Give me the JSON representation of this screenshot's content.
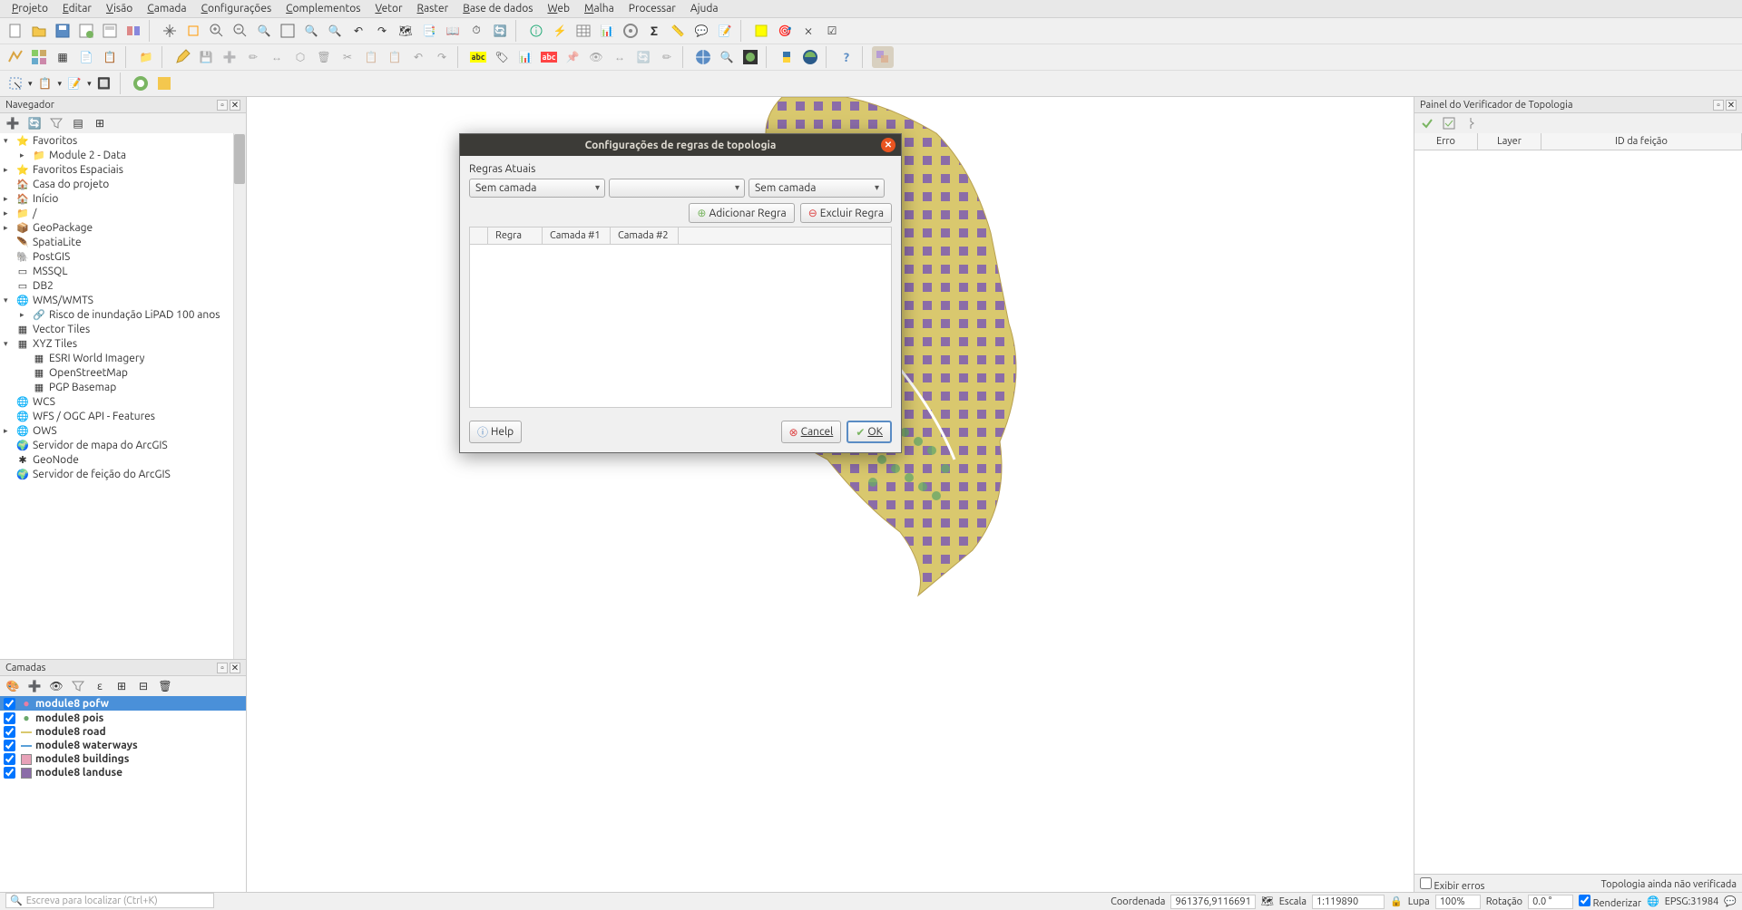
{
  "menu": [
    "Projeto",
    "Editar",
    "Visão",
    "Camada",
    "Configurações",
    "Complementos",
    "Vetor",
    "Raster",
    "Base de dados",
    "Web",
    "Malha",
    "Processar",
    "Ajuda"
  ],
  "menu_underline": [
    "P",
    "E",
    "V",
    "C",
    "C",
    "C",
    "V",
    "R",
    "B",
    "W",
    "M",
    "",
    ""
  ],
  "panels": {
    "navegador": {
      "title": "Navegador"
    },
    "camadas": {
      "title": "Camadas"
    },
    "topology": {
      "title": "Painel do Verificador de Topologia"
    }
  },
  "browser_tree": [
    {
      "lvl": 1,
      "icon": "star",
      "label": "Favoritos",
      "exp": "▾"
    },
    {
      "lvl": 2,
      "icon": "folder",
      "label": "Module 2 - Data",
      "exp": "▸"
    },
    {
      "lvl": 1,
      "icon": "star",
      "label": "Favoritos Espaciais",
      "exp": "▸"
    },
    {
      "lvl": 1,
      "icon": "home",
      "label": "Casa do projeto",
      "exp": ""
    },
    {
      "lvl": 1,
      "icon": "home",
      "label": "Início",
      "exp": "▸"
    },
    {
      "lvl": 1,
      "icon": "folder",
      "label": "/",
      "exp": "▸"
    },
    {
      "lvl": 1,
      "icon": "gpkg",
      "label": "GeoPackage",
      "exp": "▸"
    },
    {
      "lvl": 1,
      "icon": "feather",
      "label": "SpatiaLite",
      "exp": ""
    },
    {
      "lvl": 1,
      "icon": "pg",
      "label": "PostGIS",
      "exp": ""
    },
    {
      "lvl": 1,
      "icon": "ms",
      "label": "MSSQL",
      "exp": ""
    },
    {
      "lvl": 1,
      "icon": "db2",
      "label": "DB2",
      "exp": ""
    },
    {
      "lvl": 1,
      "icon": "globe",
      "label": "WMS/WMTS",
      "exp": "▾"
    },
    {
      "lvl": 2,
      "icon": "link",
      "label": "Risco de inundação LiPAD 100 anos",
      "exp": "▸"
    },
    {
      "lvl": 1,
      "icon": "grid",
      "label": "Vector Tiles",
      "exp": ""
    },
    {
      "lvl": 1,
      "icon": "grid",
      "label": "XYZ Tiles",
      "exp": "▾"
    },
    {
      "lvl": 2,
      "icon": "grid",
      "label": "ESRI World Imagery",
      "exp": ""
    },
    {
      "lvl": 2,
      "icon": "grid",
      "label": "OpenStreetMap",
      "exp": ""
    },
    {
      "lvl": 2,
      "icon": "grid",
      "label": "PGP Basemap",
      "exp": ""
    },
    {
      "lvl": 1,
      "icon": "globe",
      "label": "WCS",
      "exp": ""
    },
    {
      "lvl": 1,
      "icon": "globe",
      "label": "WFS / OGC API - Features",
      "exp": ""
    },
    {
      "lvl": 1,
      "icon": "globe",
      "label": "OWS",
      "exp": "▸"
    },
    {
      "lvl": 1,
      "icon": "arc",
      "label": "Servidor de mapa do ArcGIS",
      "exp": ""
    },
    {
      "lvl": 1,
      "icon": "geo",
      "label": "GeoNode",
      "exp": ""
    },
    {
      "lvl": 1,
      "icon": "arc",
      "label": "Servidor de feição do ArcGIS",
      "exp": ""
    }
  ],
  "layers": [
    {
      "name": "module8 pofw",
      "color": "#e87ea3",
      "symbol": "point",
      "selected": true
    },
    {
      "name": "module8 pois",
      "color": "#6aa86a",
      "symbol": "point",
      "selected": false
    },
    {
      "name": "module8 road",
      "color": "#d9c86e",
      "symbol": "line",
      "selected": false
    },
    {
      "name": "module8 waterways",
      "color": "#5aa0d8",
      "symbol": "line",
      "selected": false
    },
    {
      "name": "module8 buildings",
      "color": "#e8a2b8",
      "symbol": "poly",
      "selected": false
    },
    {
      "name": "module8 landuse",
      "color": "#8b6ca8",
      "symbol": "poly",
      "selected": false
    }
  ],
  "topology_table": {
    "cols": [
      "Erro",
      "Layer",
      "ID da feição"
    ]
  },
  "topology_footer": {
    "checkbox": "Exibir erros",
    "status": "Topologia ainda não verificada"
  },
  "dialog": {
    "title": "Configurações de regras de topologia",
    "section": "Regras Atuais",
    "combo1": "Sem camada",
    "combo2": "",
    "combo3": "Sem camada",
    "add": "Adicionar Regra",
    "del": "Excluir Regra",
    "cols": [
      "Regra",
      "Camada #1",
      "Camada #2"
    ],
    "help": "Help",
    "cancel": "Cancel",
    "ok": "OK"
  },
  "status": {
    "coord_label": "Coordenada",
    "coord": "961376,9116691",
    "scale_label": "Escala",
    "scale": "1:119890",
    "lupa_label": "Lupa",
    "lupa": "100%",
    "rot_label": "Rotação",
    "rot": "0.0 °",
    "render": "Renderizar",
    "epsg": "EPSG:31984",
    "locator_placeholder": "Escreva para localizar (Ctrl+K)"
  }
}
